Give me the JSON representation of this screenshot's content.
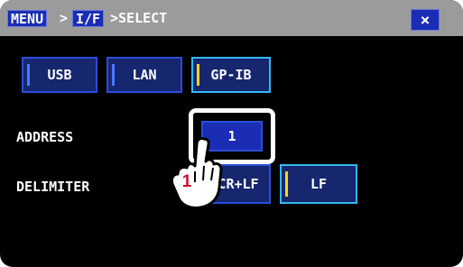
{
  "titlebar": {
    "crumbs": [
      "MENU",
      ">",
      "I/F",
      ">SELECT"
    ],
    "close_label": "×"
  },
  "interface_options": [
    "USB",
    "LAN",
    "GP-IB"
  ],
  "selected_interface": "GP-IB",
  "address": {
    "label": "ADDRESS",
    "value": "1"
  },
  "delimiter": {
    "label": "DELIMITER",
    "options": [
      "CR+LF",
      "LF"
    ],
    "selected": "LF"
  },
  "step_marker": "1",
  "colors": {
    "titlebar": "#9b9b9b",
    "button_fill": "#16266f",
    "button_border": "#2b4dd8",
    "selected_border": "#32b8f0",
    "selected_bar": "#ffd31a",
    "step_marker": "#c8102e"
  },
  "icons": {
    "close": "close-icon",
    "hand": "pointing-hand-icon"
  }
}
